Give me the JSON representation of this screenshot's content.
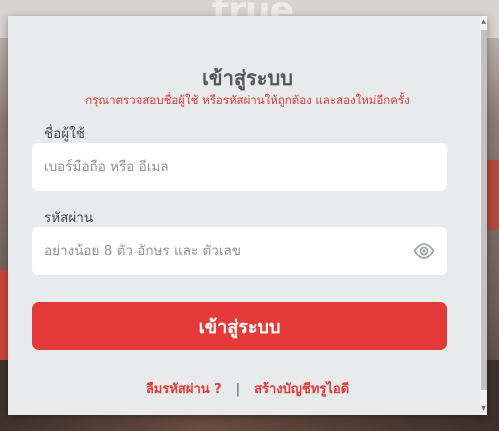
{
  "background": {
    "logo_text": "true"
  },
  "login": {
    "title": "เข้าสู่ระบบ",
    "error_message": "กรุณาตรวจสอบชื่อผู้ใช้  หรือรหัสผ่านให้ถูกต้อง และลองใหม่อีกครั้ง",
    "username": {
      "label": "ชื่อผู้ใช้",
      "placeholder": "เบอร์มือถือ หรือ อีเมล",
      "value": ""
    },
    "password": {
      "label": "รหัสผ่าน",
      "placeholder": "อย่างน้อย 8 ตัว อักษร และ ตัวเลข",
      "value": "",
      "toggle_icon": "eye-icon"
    },
    "submit_label": "เข้าสู่ระบบ",
    "forgot_password_label": "ลืมรหัสผ่าน ?",
    "separator": "|",
    "create_account_label": "สร้างบัญชีทรูไอดี"
  },
  "colors": {
    "accent": "#e53a3a",
    "modal_background": "#e9eaeb",
    "title_text": "#555659"
  }
}
